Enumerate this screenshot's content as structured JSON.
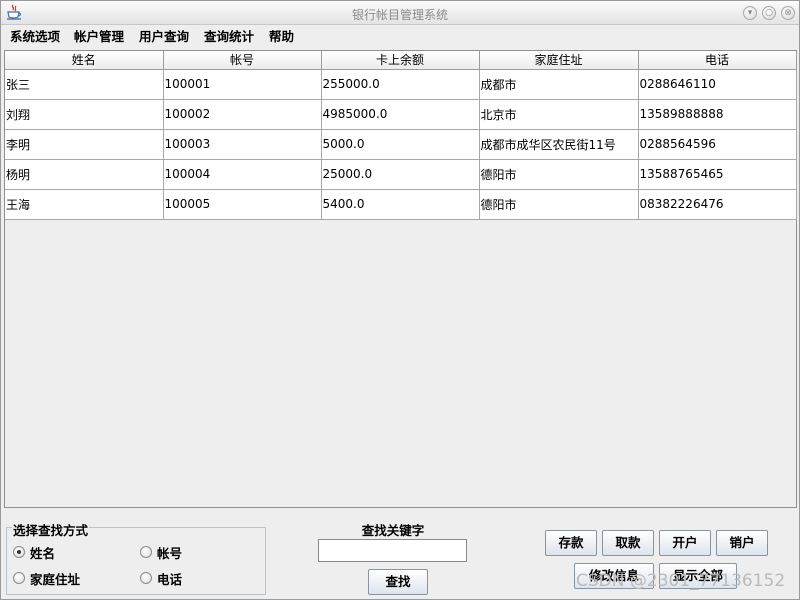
{
  "window": {
    "title": "银行帐目管理系统"
  },
  "menu": [
    "系统选项",
    "帐户管理",
    "用户查询",
    "查询统计",
    "帮助"
  ],
  "table": {
    "columns": [
      "姓名",
      "帐号",
      "卡上余额",
      "家庭住址",
      "电话"
    ],
    "rows": [
      [
        "张三",
        "100001",
        "255000.0",
        "成都市",
        "0288646110"
      ],
      [
        "刘翔",
        "100002",
        "4985000.0",
        "北京市",
        "13589888888"
      ],
      [
        "李明",
        "100003",
        "5000.0",
        "成都市成华区农民街11号",
        "0288564596"
      ],
      [
        "杨明",
        "100004",
        "25000.0",
        "德阳市",
        "13588765465"
      ],
      [
        "王海",
        "100005",
        "5400.0",
        "德阳市",
        "08382226476"
      ]
    ]
  },
  "search": {
    "group_title": "选择查找方式",
    "options": [
      {
        "label": "姓名",
        "checked": true
      },
      {
        "label": "帐号",
        "checked": false
      },
      {
        "label": "家庭住址",
        "checked": false
      },
      {
        "label": "电话",
        "checked": false
      }
    ],
    "keyword_label": "查找关键字",
    "keyword_value": "",
    "find_button": "查找"
  },
  "actions": {
    "deposit": "存款",
    "withdraw": "取款",
    "open_account": "开户",
    "close_account": "销户",
    "modify_info": "修改信息",
    "show_all": "显示全部"
  },
  "watermark": "CSDN @2301_77136152"
}
